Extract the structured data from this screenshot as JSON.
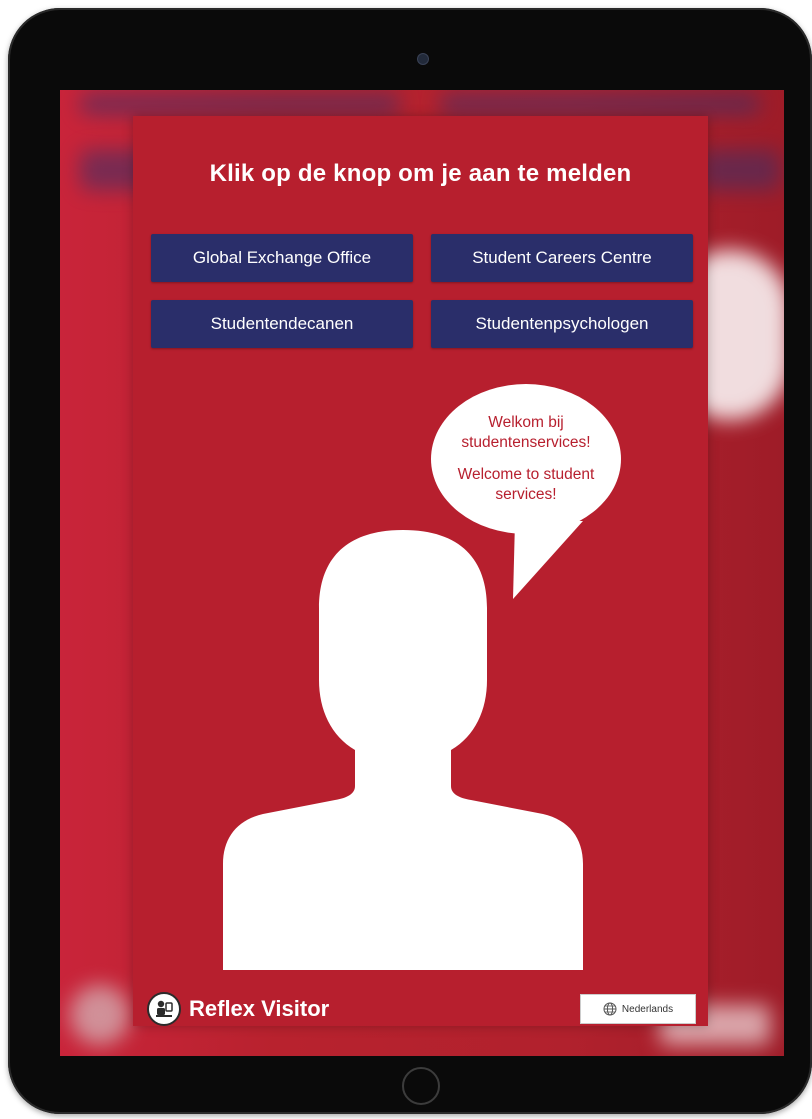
{
  "kiosk": {
    "title": "Klik op de knop om je aan te melden",
    "departments": [
      {
        "label": "Global Exchange Office"
      },
      {
        "label": "Student Careers Centre"
      },
      {
        "label": "Studentendecanen"
      },
      {
        "label": "Studentenpsychologen"
      }
    ],
    "greeting": {
      "dutch": "Welkom bij studentenservices!",
      "english": "Welcome to student services!"
    },
    "footer": {
      "brand": "Reflex Visitor",
      "language": "Nederlands",
      "language_icon": "globe-icon",
      "brand_icon": "visitor-logo-icon"
    }
  },
  "colors": {
    "background_red": "#b71f2e",
    "button_navy": "#2a2e6a",
    "bubble_text": "#b71f2e",
    "device_frame": "#0a0a0a"
  }
}
